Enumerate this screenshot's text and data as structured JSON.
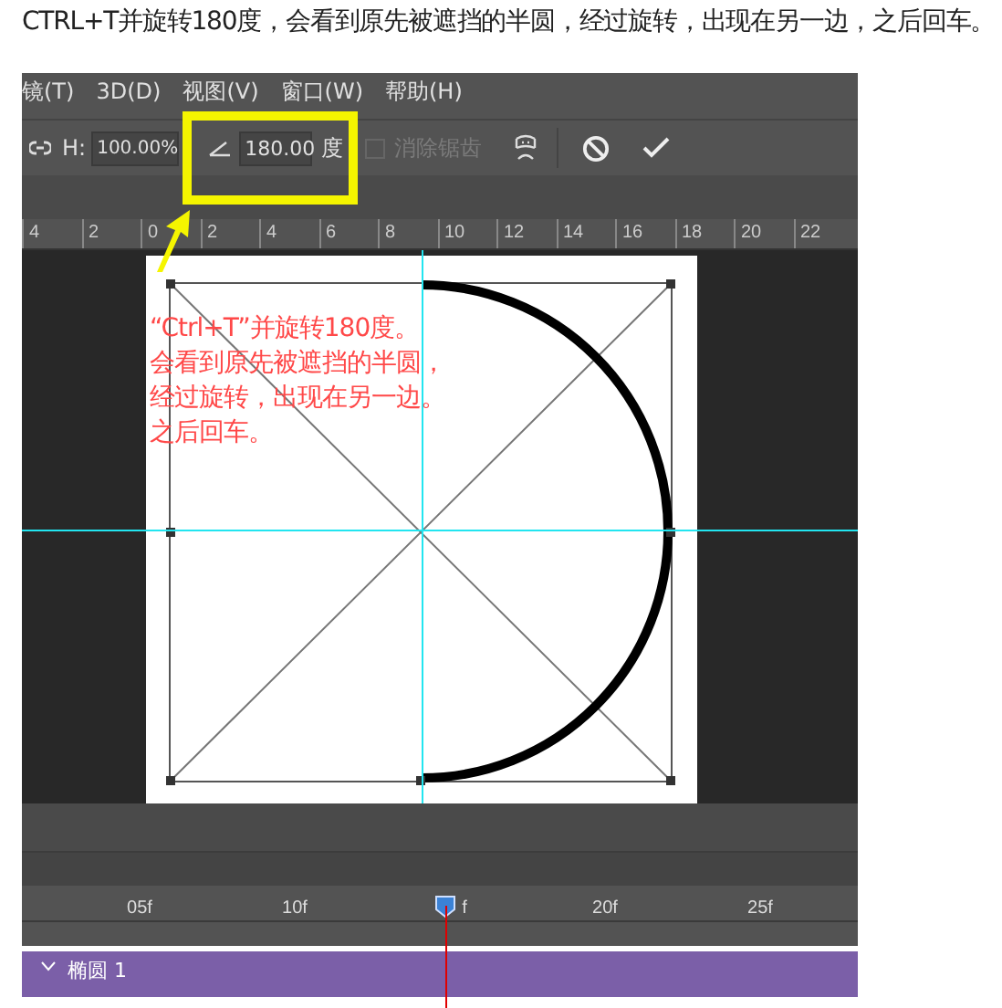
{
  "heading": "CTRL+T并旋转180度，会看到原先被遮挡的半圆，经过旋转，出现在另一边，之后回车。",
  "menu": [
    "镜(T)",
    "3D(D)",
    "视图(V)",
    "窗口(W)",
    "帮助(H)"
  ],
  "options": {
    "height_label": "H:",
    "height_value": "100.00%",
    "angle_value": "180.00",
    "angle_unit": "度",
    "antialias": {
      "label": "消除锯齿",
      "checked": false,
      "disabled": true
    }
  },
  "ruler": [
    "4",
    "2",
    "0",
    "2",
    "4",
    "6",
    "8",
    "10",
    "12",
    "14",
    "16",
    "18",
    "20",
    "22"
  ],
  "annotation": [
    "“Ctrl+T”并旋转180度。",
    "会看到原先被遮挡的半圆，",
    "经过旋转，出现在另一边。",
    "之后回车。"
  ],
  "timeline": {
    "ticks": [
      "05f",
      "10f",
      "f",
      "20f",
      "25f"
    ]
  },
  "layer": {
    "name": "椭圆 1"
  }
}
